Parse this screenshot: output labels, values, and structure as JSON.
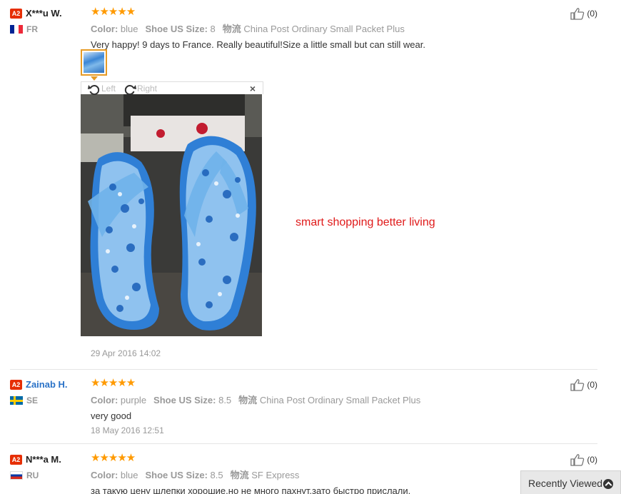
{
  "reviews": [
    {
      "level": "A2",
      "name": "X***u W.",
      "country": "FR",
      "stars": "★★★★★",
      "color_label": "Color:",
      "color_value": "blue",
      "size_label": "Shoe US Size:",
      "size_value": "8",
      "ship_label": "物流",
      "ship_value": "China Post Ordinary Small Packet Plus",
      "text": "Very happy! 9 days to France. Really beautiful!Size a little small but can still wear.",
      "date": "29 Apr 2016 14:02",
      "helpful": "(0)"
    },
    {
      "level": "A2",
      "name": "Zainab H.",
      "country": "SE",
      "stars": "★★★★★",
      "color_label": "Color:",
      "color_value": "purple",
      "size_label": "Shoe US Size:",
      "size_value": "8.5",
      "ship_label": "物流",
      "ship_value": "China Post Ordinary Small Packet Plus",
      "text": "very good",
      "date": "18 May 2016 12:51",
      "helpful": "(0)"
    },
    {
      "level": "A2",
      "name": "N***a M.",
      "country": "RU",
      "stars": "★★★★★",
      "color_label": "Color:",
      "color_value": "blue",
      "size_label": "Shoe US Size:",
      "size_value": "8.5",
      "ship_label": "物流",
      "ship_value": "SF Express",
      "text": "за такую цену шлепки хорошие.но не много пахнут.зато быстро прислали.",
      "helpful": "(0)"
    }
  ],
  "viewer": {
    "rotate_left": "Left",
    "rotate_right": "Right",
    "close": "×"
  },
  "promo_text": "smart shopping better living",
  "recently_viewed": "Recently Viewed",
  "colors": {
    "star": "#ff9a00",
    "level_badge": "#e62e04",
    "promo": "#e01a1a",
    "link": "#2a72c7"
  }
}
